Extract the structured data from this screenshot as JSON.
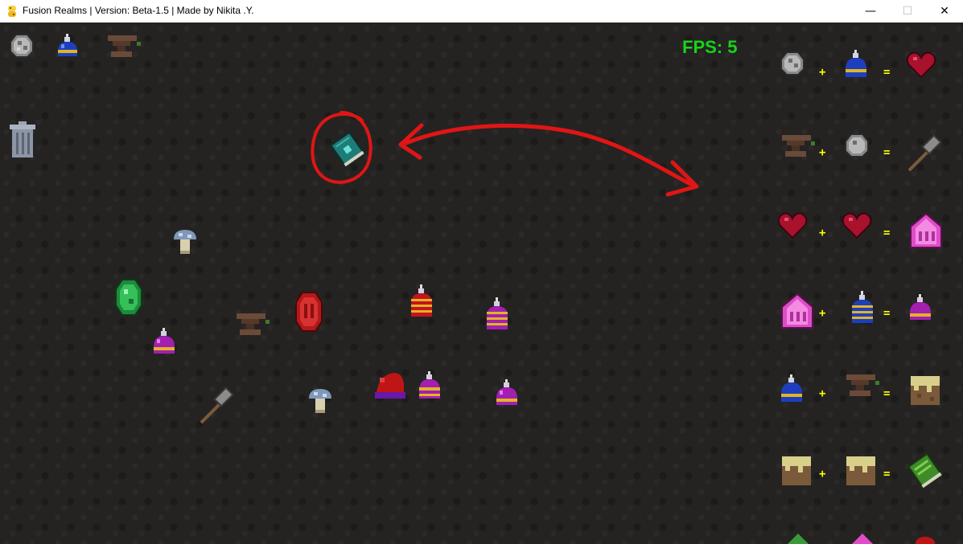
{
  "window": {
    "title": "Fusion Realms | Version: Beta-1.5 | Made by Nikita .Y.",
    "minimize": "—",
    "maximize": "☐",
    "close": "✕"
  },
  "hud": {
    "fps": "FPS: 5"
  },
  "recipes": {
    "plus": "+",
    "equals": "="
  },
  "colors": {
    "fps": "#17d417",
    "recipe_symbols": "#ffff00",
    "annotation": "#e01515"
  }
}
